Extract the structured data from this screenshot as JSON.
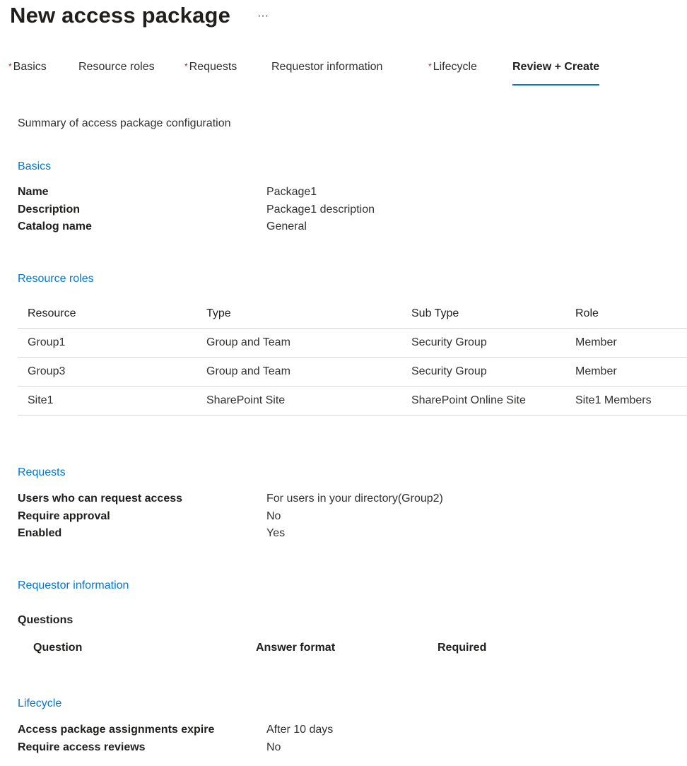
{
  "header": {
    "title": "New access package",
    "more_label": "···"
  },
  "tabs": [
    {
      "label": "Basics",
      "required": true,
      "required_mark": "*"
    },
    {
      "label": "Resource roles",
      "required": false
    },
    {
      "label": "Requests",
      "required": true,
      "required_mark": "*"
    },
    {
      "label": "Requestor information",
      "required": false
    },
    {
      "label": "Lifecycle",
      "required": true,
      "required_mark": "*"
    },
    {
      "label": "Review + Create",
      "required": false,
      "active": true
    }
  ],
  "summary": "Summary of access package configuration",
  "basics": {
    "heading": "Basics",
    "rows": [
      {
        "key": "Name",
        "value": "Package1"
      },
      {
        "key": "Description",
        "value": "Package1 description"
      },
      {
        "key": "Catalog name",
        "value": "General"
      }
    ]
  },
  "resource_roles": {
    "heading": "Resource roles",
    "columns": [
      "Resource",
      "Type",
      "Sub Type",
      "Role"
    ],
    "rows": [
      [
        "Group1",
        "Group and Team",
        "Security Group",
        "Member"
      ],
      [
        "Group3",
        "Group and Team",
        "Security Group",
        "Member"
      ],
      [
        "Site1",
        "SharePoint Site",
        "SharePoint Online Site",
        "Site1 Members"
      ]
    ]
  },
  "requests": {
    "heading": "Requests",
    "rows": [
      {
        "key": "Users who can request access",
        "value": "For users in your directory(Group2)"
      },
      {
        "key": "Require approval",
        "value": "No"
      },
      {
        "key": "Enabled",
        "value": "Yes"
      }
    ]
  },
  "requestor_information": {
    "heading": "Requestor information",
    "questions_label": "Questions",
    "columns": [
      "Question",
      "Answer format",
      "Required"
    ]
  },
  "lifecycle": {
    "heading": "Lifecycle",
    "rows": [
      {
        "key": "Access package assignments expire",
        "value": "After 10 days"
      },
      {
        "key": "Require access reviews",
        "value": "No"
      }
    ]
  },
  "colors": {
    "accent": "#0078d4",
    "required_mark": "#a4262c",
    "text": "#323130"
  }
}
